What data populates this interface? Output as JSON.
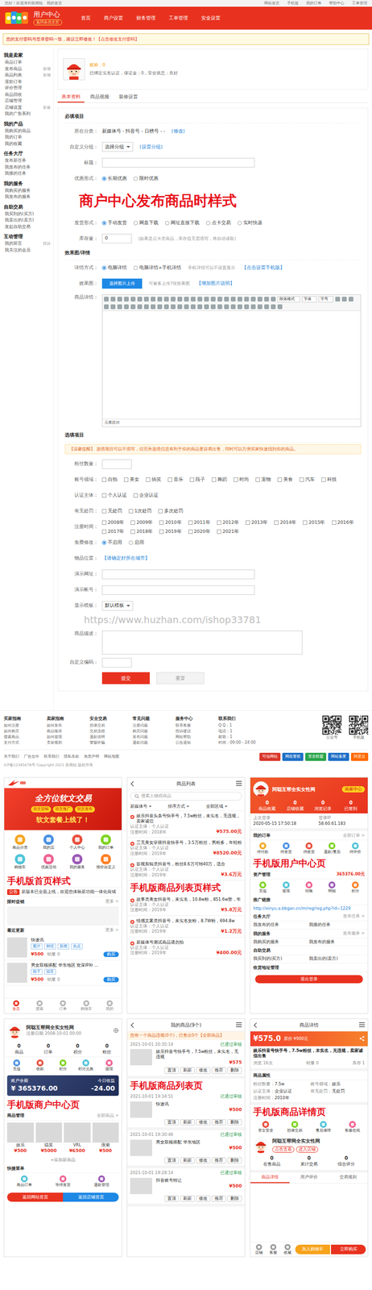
{
  "topbar": {
    "welcome": "您好！欢迎来到新闻站",
    "area": "我的首页",
    "links": [
      "网站首页",
      "手机版",
      "我的订单",
      "帮助中心",
      "工单管理"
    ]
  },
  "header": {
    "title": "用户中心",
    "subtitle": "返回会员主页",
    "nav": [
      "首页",
      "商户设置",
      "财务管理",
      "工单管理",
      "安全设置"
    ]
  },
  "warning": {
    "text": "您的支付密码与登录密码一致，建议立即修改！",
    "link": "【点击修改支付密码】"
  },
  "sidebar": [
    {
      "title": "我是卖家",
      "items": [
        {
          "label": "商品订单"
        },
        {
          "label": "发布商品",
          "tag": "新增"
        },
        {
          "label": "商品列表",
          "tag": "新增"
        },
        {
          "label": "退款订单"
        },
        {
          "label": "评价管理"
        },
        {
          "label": "商品回收"
        },
        {
          "label": "店铺管理"
        },
        {
          "label": "店铺设置",
          "tag": "装修"
        },
        {
          "label": "我的广告系列"
        }
      ]
    },
    {
      "title": "我的产品",
      "items": [
        {
          "label": "我购买的商品"
        },
        {
          "label": "我的订单"
        },
        {
          "label": "我的收藏"
        }
      ]
    },
    {
      "title": "任务大厅",
      "items": [
        {
          "label": "发布新任务"
        },
        {
          "label": "我发布的任务"
        },
        {
          "label": "我接的任务"
        }
      ]
    },
    {
      "title": "我的服务",
      "items": [
        {
          "label": "我购买的服务"
        },
        {
          "label": "我发布的服务"
        }
      ]
    },
    {
      "title": "自助交易",
      "items": [
        {
          "label": "我买到的(买方)"
        },
        {
          "label": "我卖出的(卖方)"
        },
        {
          "label": "发起自助交易"
        }
      ]
    },
    {
      "title": "互动管理",
      "items": [
        {
          "label": "我的留言",
          "tag": "投诉"
        },
        {
          "label": "我关注的会员"
        }
      ]
    }
  ],
  "profile": {
    "nick": "昵称：0",
    "status": "已绑定实名认证，保证金：0，安全状态：良好"
  },
  "tabs": [
    {
      "label": "基本资料",
      "selected": true
    },
    {
      "label": "商品视频",
      "selected": false
    },
    {
      "label": "装修设置",
      "selected": false
    }
  ],
  "form": [
    {
      "kind": "section",
      "label": "必填项目"
    },
    {
      "kind": "text",
      "label": "所在分类：",
      "value": "新媒体号 - 抖音号 - 日榜号 - -",
      "link": "[修改]"
    },
    {
      "kind": "select",
      "label": "自定义分组：",
      "value": "选择分组",
      "link": "[设置分组]"
    },
    {
      "kind": "input",
      "label": "标题："
    },
    {
      "kind": "radio",
      "label": "优惠形式：",
      "options": [
        {
          "label": "长期优惠",
          "selected": true
        },
        {
          "label": "限时优惠",
          "selected": false
        }
      ]
    },
    {
      "kind": "overlay",
      "label": "商户中心发布商品时样式"
    },
    {
      "kind": "radio",
      "label": "发货形式：",
      "options": [
        {
          "label": "手动发货",
          "selected": true
        },
        {
          "label": "网盘下载",
          "selected": false
        },
        {
          "label": "网址直接下载",
          "selected": false
        },
        {
          "label": "点卡交易",
          "selected": false
        },
        {
          "label": "实时快递",
          "selected": false
        }
      ]
    },
    {
      "kind": "number",
      "label": "库存量：",
      "value": "0",
      "hint": "(如果是点卡类商品，库存值无需填写，将自动读取)"
    },
    {
      "kind": "section",
      "label": "效果图/详情"
    },
    {
      "kind": "radio",
      "label": "详情方式：",
      "options": [
        {
          "label": "电脑详情",
          "selected": true
        },
        {
          "label": "电脑详情+手机详情",
          "selected": false
        }
      ],
      "hint": "手机详情可以不设置显示",
      "link": "【点击设置手机版】"
    },
    {
      "kind": "upload",
      "label": "效果图：",
      "button": "选择图片上传",
      "hint": "可最多上传7张效果图",
      "link": "【增加图片说明】"
    },
    {
      "kind": "editor",
      "label": "商品详情：",
      "selects": [
        "段落格式",
        "字体",
        "字号"
      ],
      "status": "元素路径"
    },
    {
      "kind": "section",
      "label": "选填项目"
    },
    {
      "kind": "notice",
      "label": "【温馨提醒】 选填项目可以不填写，但完善选填信息有利于你的商品更容易出售，同时可以方便买家快速找到你的商品。"
    },
    {
      "kind": "number",
      "label": "粉丝数量："
    },
    {
      "kind": "check",
      "label": "账号领域：",
      "options": [
        {
          "label": "自拍",
          "checked": false
        },
        {
          "label": "美女",
          "checked": false
        },
        {
          "label": "搞笑",
          "checked": false
        },
        {
          "label": "音乐",
          "checked": false
        },
        {
          "label": "段子",
          "checked": false
        },
        {
          "label": "舞蹈",
          "checked": false
        },
        {
          "label": "时尚",
          "checked": false
        },
        {
          "label": "宠物",
          "checked": false
        },
        {
          "label": "美食",
          "checked": false
        },
        {
          "label": "汽车",
          "checked": false
        },
        {
          "label": "科技",
          "checked": false
        }
      ]
    },
    {
      "kind": "check",
      "label": "认证主体：",
      "options": [
        {
          "label": "个人认证",
          "checked": false
        },
        {
          "label": "企业认证",
          "checked": false
        }
      ]
    },
    {
      "kind": "check",
      "label": "有无处罚：",
      "options": [
        {
          "label": "无处罚",
          "checked": false
        },
        {
          "label": "1次处罚",
          "checked": false
        },
        {
          "label": "多次处罚",
          "checked": false
        }
      ]
    },
    {
      "kind": "check",
      "label": "注册时间：",
      "options": [
        {
          "label": "2008年",
          "checked": false
        },
        {
          "label": "2009年",
          "checked": false
        },
        {
          "label": "2010年",
          "checked": false
        },
        {
          "label": "2011年",
          "checked": false
        },
        {
          "label": "2012年",
          "checked": false
        },
        {
          "label": "2013年",
          "checked": false
        },
        {
          "label": "2014年",
          "checked": false
        },
        {
          "label": "2015年",
          "checked": false
        },
        {
          "label": "2016年",
          "checked": false
        },
        {
          "label": "2017年",
          "checked": false
        },
        {
          "label": "2018年",
          "checked": false
        },
        {
          "label": "2019年",
          "checked": false
        },
        {
          "label": "2020年",
          "checked": false
        },
        {
          "label": "2021年",
          "checked": false
        }
      ]
    },
    {
      "kind": "radio",
      "label": "免费修改：",
      "options": [
        {
          "label": "不启用",
          "selected": true
        },
        {
          "label": "启用",
          "selected": false
        }
      ]
    },
    {
      "kind": "text",
      "label": "物品位置：",
      "value": "【请确定好所在城市】"
    },
    {
      "kind": "input",
      "label": "演示网址："
    },
    {
      "kind": "input",
      "label": "演示帐号："
    },
    {
      "kind": "select",
      "label": "显示模板：",
      "value": "默认模板"
    },
    {
      "kind": "watermark",
      "label": "https://www.huzhan.com/ishop33781"
    },
    {
      "kind": "textarea",
      "label": "商品描述："
    },
    {
      "kind": "number",
      "label": "自定义编码："
    },
    {
      "kind": "buttons",
      "buttons": [
        "提交",
        "重置"
      ]
    }
  ],
  "footer": {
    "columns": [
      {
        "title": "买家指南",
        "links": [
          "如何注册",
          "如何购买",
          "搜索商品",
          "支付方式"
        ]
      },
      {
        "title": "卖家指南",
        "links": [
          "如何发布",
          "商品推荐",
          "如何提现",
          "卖家规则"
        ]
      },
      {
        "title": "安全交易",
        "links": [
          "担保交易",
          "交易流程",
          "退款说明",
          "警惕诈骗"
        ]
      },
      {
        "title": "常见问题",
        "links": [
          "注册问题",
          "购买问题",
          "发布问题",
          "退款问题"
        ]
      },
      {
        "title": "服务中心",
        "links": [
          "联系客服",
          "投诉建议",
          "网站帮助",
          "公告通知"
        ]
      }
    ],
    "contact": {
      "title": "联系我们",
      "lines": [
        "Q Q：1",
        "电话：1",
        "邮箱：1",
        "时间：09:00 - 24:00"
      ]
    },
    "qr": [
      "公众号",
      "手机版"
    ],
    "links": [
      "关于我们",
      "广告合作",
      "联系我们",
      "隐私条款",
      "免责声明",
      "网站地图"
    ],
    "badges": [
      {
        "label": "可信网站",
        "color": "#d9362b"
      },
      {
        "label": "网络警察",
        "color": "#1f6fc6"
      },
      {
        "label": "安全联盟",
        "color": "#2aa44a"
      },
      {
        "label": "网站备案",
        "color": "#1f6fc6"
      },
      {
        "label": "阿里云",
        "color": "#ff6a00"
      }
    ],
    "copyright": "ICP备12345678号  Copyright 2021 新闻站 版权所有"
  },
  "mobile": {
    "home": {
      "label": "手机版首页样式",
      "banner": {
        "title": "全方位软文交易",
        "tags": [
          "软文营销",
          "软文推广",
          "软文发布"
        ],
        "sub": "软文套餐上线了！"
      },
      "icons": [
        "商品分类",
        "我的店",
        "个人中心",
        "我的订单",
        "购物车",
        "优惠活动",
        "我的服务",
        "报价自定义"
      ],
      "notice": {
        "tag": "公告",
        "text": "新版本已全面上线，欢迎您体验新功能一体化商城"
      },
      "sections": [
        {
          "title": "限时促销",
          "more": "更多 >"
        },
        {
          "title": "最近更新",
          "more": "更多 >"
        }
      ],
      "items": [
        {
          "title": "快速讯",
          "tags": [
            "图片",
            "财经",
            "新闻",
            "热点"
          ],
          "price": "¥500",
          "sold": "销量 0",
          "btn": "购买"
        },
        {
          "title": "男女双模搭配 华东地区 资深IP补 ...",
          "tags": [
            "段子",
            "搞笑"
          ],
          "price": "¥500",
          "sold": "销量 0",
          "btn": "购买"
        }
      ],
      "tabbar": [
        {
          "label": "首页",
          "selected": true
        },
        {
          "label": "搜索",
          "selected": false
        },
        {
          "label": "订单",
          "selected": false
        },
        {
          "label": "购物车",
          "selected": false
        },
        {
          "label": "我的",
          "selected": false
        }
      ]
    },
    "list": {
      "label": "手机版商品列表页样式",
      "title": "商品列表",
      "search": "搜索人物或商品",
      "filters": [
        "新媒体号",
        "排序方式",
        "全部区域"
      ],
      "items": [
        {
          "title": "娱乐抖音头条号快手号，7.5w粉丝，未实名，无违规，卖家诚信",
          "meta": [
            "认证主体：个人认证",
            "注册时间：2018年"
          ],
          "price": "¥575.00元"
        },
        {
          "title": "三无美女穿搭抖音快手号，3.5万粉丝，男粉多，年轻粉",
          "meta": [
            "认证主体：个人认证",
            "注册时间：2019年"
          ],
          "price": "¥8520.00元"
        },
        {
          "title": "影视剪辑类抖音号，粉丝8.6万可转40万，适合",
          "meta": [
            "认证主体：个人认证",
            "注册时间：2019年"
          ],
          "price": "¥3.6万元"
        },
        {
          "title": "故事类美女抖音号，未实名，10.8w粉，851.6w赞，年",
          "meta": [
            "认证主体：个人认证",
            "注册时间：2019年"
          ],
          "price": "¥5.8万元"
        },
        {
          "title": "情感文案类抖音号，未实名女粉，8.7W粉，694.8w",
          "meta": [
            "认证主体：个人认证",
            "注册时间：2019年"
          ],
          "price": "¥1.2万元"
        },
        {
          "title": "新媒体号测试商品请勿拍",
          "meta": [
            "认证主体：个人认证",
            "注册时间：2019年"
          ],
          "price": "¥400.00元"
        }
      ]
    },
    "user": {
      "label": "手机版用户中心页",
      "name": "阿聪互帮全实女性网",
      "badges": [
        "商家中心"
      ],
      "stats": [
        {
          "num": "0",
          "text": "商品收藏"
        },
        {
          "num": "0",
          "text": "店铺收藏"
        },
        {
          "num": "0",
          "text": "浏览记录"
        },
        {
          "num": "0",
          "text": "已签到"
        }
      ],
      "login": [
        {
          "k": "上次登录",
          "v": "2020-05-15 17:50:18"
        },
        {
          "k": "登录IP",
          "v": "58.60.61.183"
        }
      ],
      "orders": {
        "title": "我的订单",
        "more": "全部订单 >",
        "icons": [
          "待付款",
          "待发货",
          "待收货",
          "退款/售后",
          "待评价"
        ]
      },
      "assets": {
        "title": "资产管理",
        "amount": "365376.00元",
        "icons": [
          "充值",
          "提现",
          "转账",
          "明细",
          "积分"
        ]
      },
      "promo": {
        "title": "推广链接",
        "url": "http://xinyu.a.bbgan.cn/m/reg/reg.php?id=1229"
      },
      "groups": [
        {
          "title": "任务大厅",
          "more": "发布任务 >",
          "rows": [
            "我发布的任务",
            "我接的任务"
          ]
        },
        {
          "title": "我的服务",
          "more": "发布服务 >",
          "rows": [
            "我购买的服务",
            "我发布的服务"
          ]
        },
        {
          "title": "自助交易",
          "rows": [
            "我买到的(买方)",
            "我卖出的(卖方)"
          ]
        },
        {
          "title": "收货地址管理",
          "rows": []
        }
      ],
      "logout": "退出登录"
    },
    "merchant": {
      "label": "手机版商户中心页",
      "name": "阿聪互帮网全实女性网",
      "date": "注册日期 2008-10-01 00:00",
      "stats": [
        {
          "num": "0",
          "text": "商品"
        },
        {
          "num": "0",
          "text": "订单"
        },
        {
          "num": "0",
          "text": "积分"
        },
        {
          "num": "0",
          "text": "粉丝"
        }
      ],
      "icons": [
        "充值",
        "收款",
        "积分",
        "积分兑换",
        "提现"
      ],
      "balance": {
        "title": "账户余额",
        "amount": "¥ 365376.00",
        "side": "今日收益",
        "sideval": "-24.00"
      },
      "goods": {
        "title": "商品管理",
        "more": "全部商品 >",
        "items": [
          {
            "name": "娱乐",
            "price": "¥500"
          },
          {
            "name": "搞笑",
            "price": "¥5000"
          },
          {
            "name": "VRL",
            "price": "¥6500"
          },
          {
            "name": "浪潮",
            "price": "¥500"
          }
        ],
        "add": "+添加新商品"
      },
      "quick": {
        "title": "快捷菜单",
        "items": [
          "商品订单",
          "等待发货",
          "退款管理"
        ]
      },
      "buttons": [
        "返回网站首页",
        "返回店铺首页"
      ]
    },
    "mylist": {
      "label": "手机版商品列表页",
      "title": "我的商品(9个)",
      "notice": "您有一个商品违规(0个)，已售出0个【全部商品】",
      "actions": [
        "置顶",
        "刷新",
        "修改",
        "推荐",
        "删除"
      ],
      "items": [
        {
          "date": "2021-10-01 20:35:14",
          "status": "已通过审核",
          "title": "娱乐抖音号快手号，7.5w粉丝，未实名，无违规",
          "price": "¥575"
        },
        {
          "date": "2021-10-01 19:34:51",
          "status": "已通过审核",
          "title": "快速讯",
          "price": "¥500"
        },
        {
          "date": "2021-10-01 19:30:46",
          "status": "已通过审核",
          "title": "男女双模搭配 华东地区",
          "price": "¥500"
        },
        {
          "date": "2021-10-01 19:28:14",
          "status": "已通过审核",
          "title": "抖音账号转让",
          "price": "¥500"
        }
      ]
    },
    "detail": {
      "label": "手机版商品详情页",
      "title": "商品详情",
      "price": "¥575.0",
      "orig": "原价 ¥900元",
      "desc": "娱乐抖音号快手号，7.5w粉丝，未实名，无违规，卖家诚信出售",
      "meta": [
        "浏览 16次",
        "销量 0",
        "库存 1"
      ],
      "attrs_title": "商品属性",
      "attrs": [
        {
          "k": "粉丝数量：",
          "v": "7.5w"
        },
        {
          "k": "账号领域：",
          "v": "娱乐"
        },
        {
          "k": "认证主体：",
          "v": "企业认证"
        },
        {
          "k": "有无处罚：",
          "v": "无处罚"
        },
        {
          "k": "注册时间：",
          "v": "2010年"
        }
      ],
      "guarantees": [
        "资金安全",
        "担保交易",
        "售后保障",
        "客服在线"
      ],
      "seller": {
        "name": "阿聪互帮网全实女性网",
        "tags": [
          "点击查看",
          "进入店铺"
        ],
        "stats": [
          {
            "num": "0",
            "text": "在售商品"
          },
          {
            "num": "0",
            "text": "累计交易"
          },
          {
            "num": "0",
            "text": "综合评分"
          }
        ]
      },
      "tabs": [
        {
          "label": "商品详情",
          "selected": true
        },
        {
          "label": "用户评价",
          "selected": false
        },
        {
          "label": "交易规则",
          "selected": false
        }
      ],
      "bar": [
        {
          "label": "店铺",
          "kind": "icon"
        },
        {
          "label": "客服",
          "kind": "icon"
        },
        {
          "label": "收藏",
          "kind": "icon"
        },
        {
          "label": "加入购物车",
          "kind": "button"
        },
        {
          "label": "立即购买",
          "kind": "button"
        }
      ]
    }
  }
}
